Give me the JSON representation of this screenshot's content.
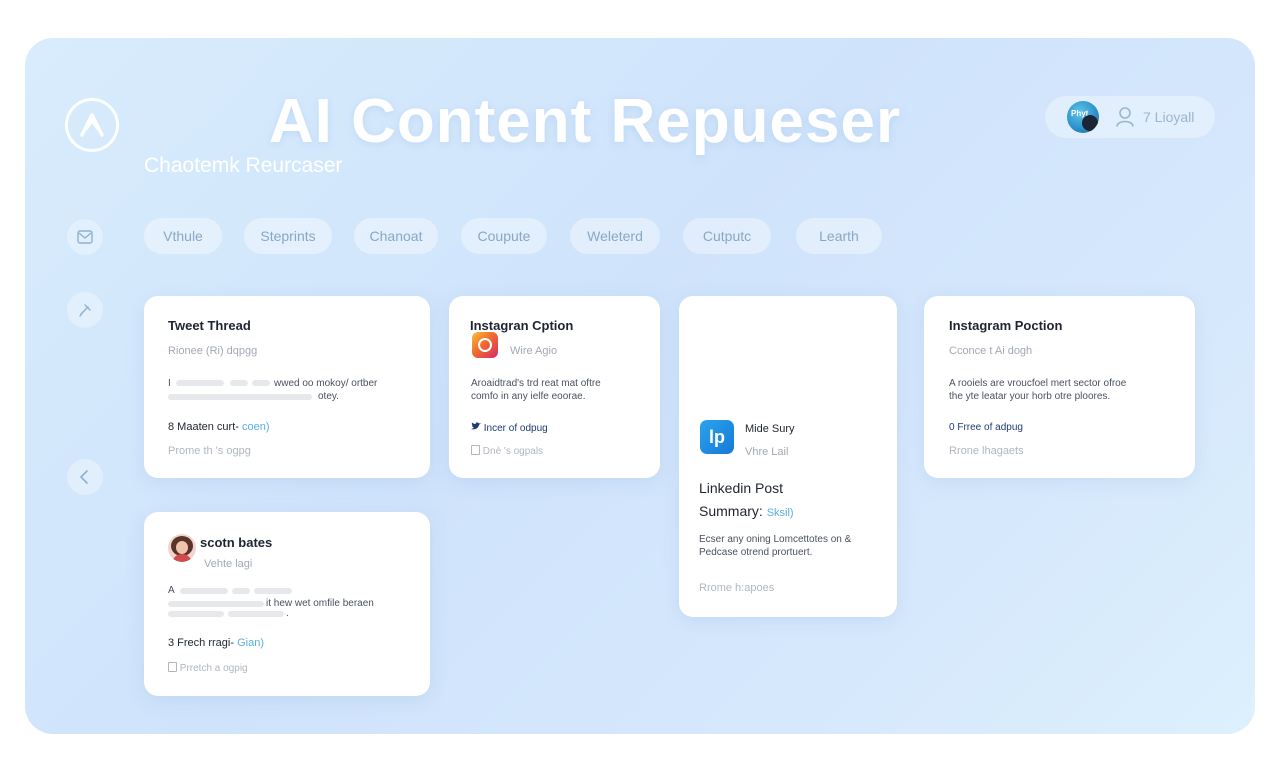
{
  "header": {
    "title": "AI Content Repueser",
    "subtitle": "Chaotemk Reurcaser",
    "profile": {
      "avatar_tag": "Phyt",
      "user_label": "7 Lioyall"
    }
  },
  "tabs": [
    "Vthule",
    "Steprints",
    "Chanoat",
    "Coupute",
    "Weleterd",
    "Cutputc",
    "Learth"
  ],
  "icons": {
    "logo": "ai-logo-icon",
    "side_top": "mail-icon",
    "side_mid": "pin-icon",
    "side_back": "chevron-left-icon",
    "user": "user-icon"
  },
  "cards": {
    "tweet": {
      "title": "Tweet Thread",
      "sub": "Rionee (Ri) dqpgg",
      "body_prefix": "I",
      "body_l1_end": "wwed oo mokoy/ ortber",
      "body_l2_end": "otey.",
      "meta": "8 Maaten curt-",
      "meta_accent": "coen)",
      "foot": "Prome th 's ogpg"
    },
    "ig_caption": {
      "title": "Instagran Cption",
      "sub": "Wire Agio",
      "body_l1": "Aroaidtrad's trd reat mat oftre",
      "body_l2": "comfo in any ielfe eoorae.",
      "meta": "Incer of odpug",
      "foot": "Dnè 's ogpals"
    },
    "linkedin": {
      "icon_glyph": "lp",
      "name": "Mide Sury",
      "handle": "Vhre Lail",
      "title_l1": "Linkedin Post",
      "title_l2": "Summary:",
      "title_accent": "Sksil)",
      "body_l1": "Ecser any oning Lomcettotes on &",
      "body_l2": "Pedcase otrend prortuert.",
      "foot": "Rrome h:apoes"
    },
    "ig_post": {
      "title": "Instagram Poction",
      "sub": "Cconce t Ai dogh",
      "body_l1": "A rooiels are vroucfoel mert sector ofroe",
      "body_l2": "the yte leatar your horb otre ploores.",
      "meta": "0 Frree of adpug",
      "foot": "Rrone lhagaets"
    },
    "scoth": {
      "title": "scotn bates",
      "sub": "Vehte lagi",
      "body_prefix": "A",
      "body_l2_end": "it hew wet omfile beraen",
      "body_l3_end": ".",
      "meta": "3 Frech rragi-",
      "meta_accent": "Gian)",
      "foot": "Prretch a ogpig"
    }
  },
  "colors": {
    "panel_bg": "#d2e6fc",
    "accent": "#5aaee0",
    "linkedin": "#1679d6"
  }
}
